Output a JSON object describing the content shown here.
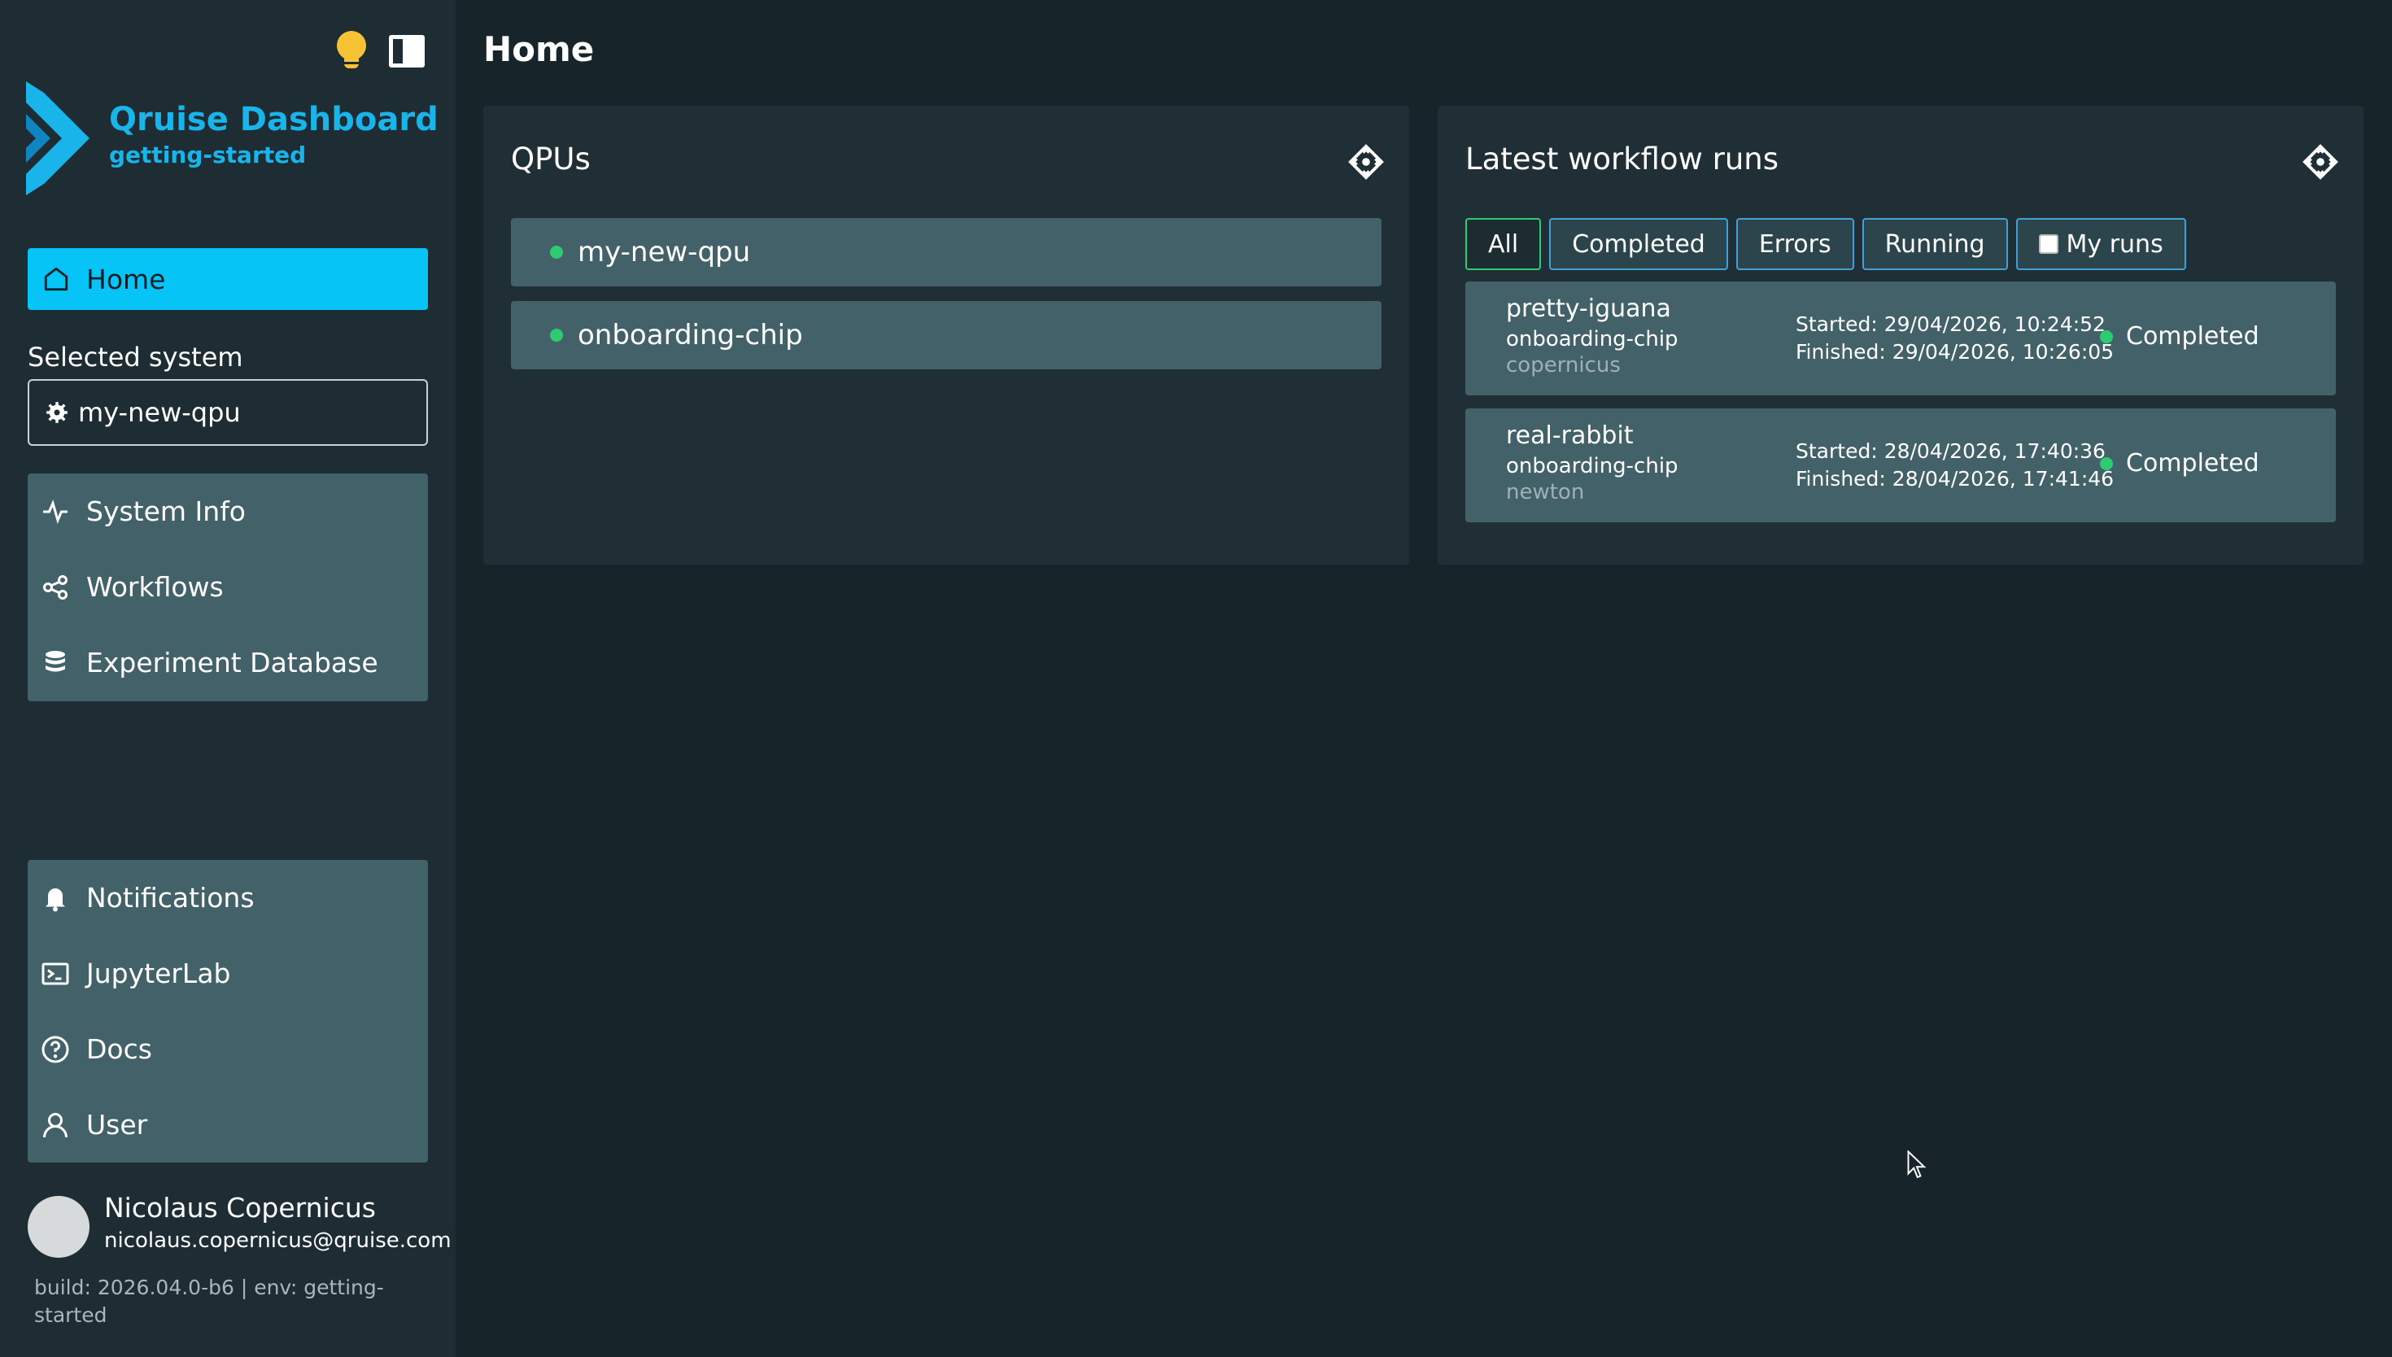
{
  "sidebar": {
    "brand_title": "Qruise Dashboard",
    "brand_subtitle": "getting-started",
    "home_label": "Home",
    "selected_system_label": "Selected system",
    "selected_system_value": "my-new-qpu",
    "nav_primary": [
      {
        "label": "System Info",
        "icon": "activity-icon"
      },
      {
        "label": "Workflows",
        "icon": "share-icon"
      },
      {
        "label": "Experiment Database",
        "icon": "database-icon"
      }
    ],
    "nav_secondary": [
      {
        "label": "Notifications",
        "icon": "bell-icon"
      },
      {
        "label": "JupyterLab",
        "icon": "terminal-icon"
      },
      {
        "label": "Docs",
        "icon": "help-circle-icon"
      },
      {
        "label": "User",
        "icon": "user-icon"
      }
    ],
    "user": {
      "name": "Nicolaus Copernicus",
      "email": "nicolaus.copernicus@qruise.com"
    },
    "build_info": "build: 2026.04.0-b6 | env: getting-started"
  },
  "main": {
    "page_title": "Home",
    "qpus_card": {
      "title": "QPUs",
      "items": [
        "my-new-qpu",
        "onboarding-chip"
      ]
    },
    "runs_card": {
      "title": "Latest workflow runs",
      "filters": {
        "all": "All",
        "completed": "Completed",
        "errors": "Errors",
        "running": "Running",
        "my_runs": "My runs"
      },
      "runs": [
        {
          "name": "pretty-iguana",
          "system": "onboarding-chip",
          "user": "copernicus",
          "started": "Started: 29/04/2026, 10:24:52",
          "finished": "Finished: 29/04/2026, 10:26:05",
          "status": "Completed"
        },
        {
          "name": "real-rabbit",
          "system": "onboarding-chip",
          "user": "newton",
          "started": "Started: 28/04/2026, 17:40:36",
          "finished": "Finished: 28/04/2026, 17:41:46",
          "status": "Completed"
        }
      ]
    }
  },
  "colors": {
    "accent": "#06c5f6",
    "brand": "#19b4ea",
    "status_ok": "#2ecc71",
    "bulb": "#f7c233"
  }
}
